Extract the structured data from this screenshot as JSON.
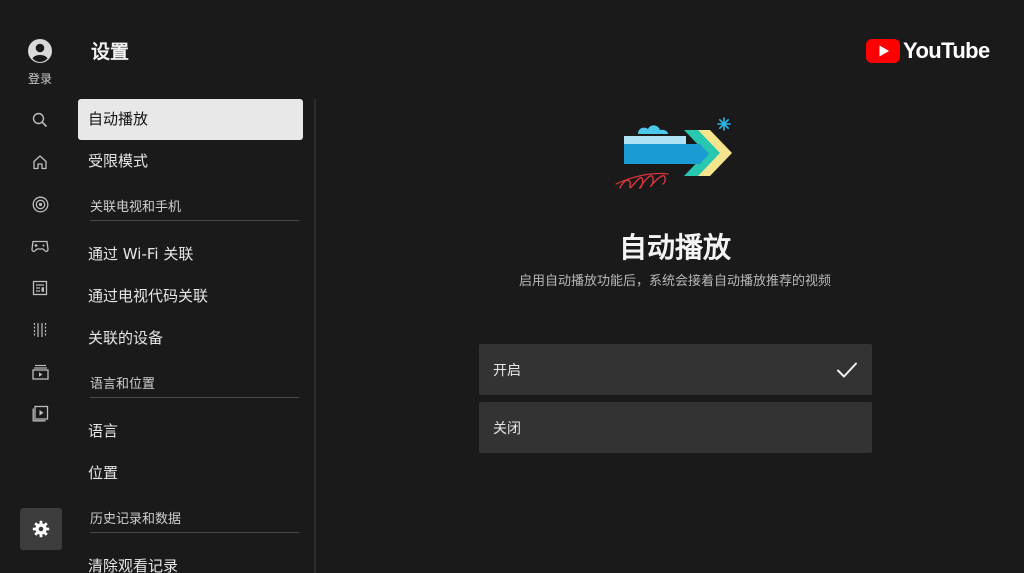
{
  "rail": {
    "login_label": "登录",
    "icons": [
      "search-icon",
      "home-icon",
      "subscriptions-icon",
      "gaming-icon",
      "news-icon",
      "movies-icon",
      "channels-icon",
      "library-icon"
    ],
    "settings_icon": "gear-icon"
  },
  "settings": {
    "title": "设置",
    "items": {
      "autoplay": "自动播放",
      "restricted": "受限模式",
      "section_link_tv": "关联电视和手机",
      "link_wifi": "通过 Wi-Fi 关联",
      "link_code": "通过电视代码关联",
      "linked_devices": "关联的设备",
      "section_language": "语言和位置",
      "language": "语言",
      "location": "位置",
      "section_history": "历史记录和数据",
      "clear_history": "清除观看记录"
    }
  },
  "brand": {
    "name": "YouTube",
    "color": "#ff0000"
  },
  "panel": {
    "title": "自动播放",
    "description": "启用自动播放功能后，系统会接着自动播放推荐的视频",
    "options": [
      {
        "label": "开启",
        "selected": true
      },
      {
        "label": "关闭",
        "selected": false
      }
    ]
  },
  "colors": {
    "background": "#1a1a1a",
    "selected_item": "#e8e8e8",
    "option_bg": "#333333",
    "accent_blue": "#1a9bd2",
    "accent_teal": "#27c7b0",
    "accent_yellow": "#f6e58d",
    "accent_red": "#d9363e"
  }
}
